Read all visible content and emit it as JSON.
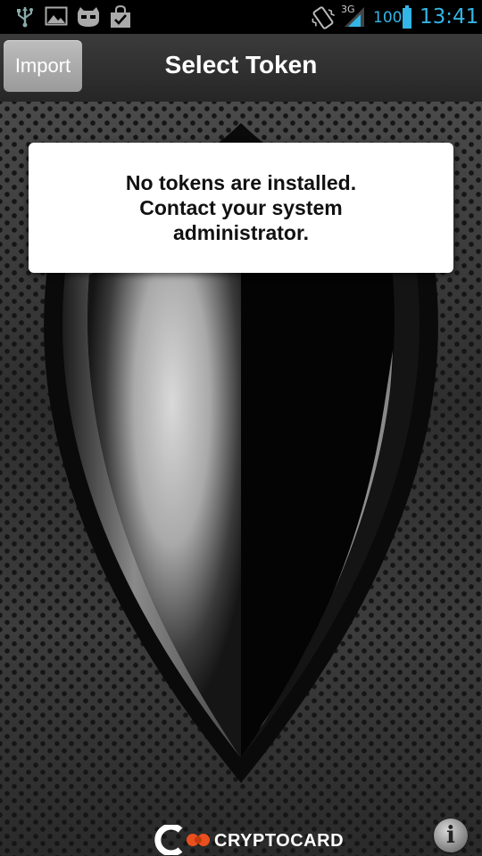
{
  "status_bar": {
    "battery_level": "100",
    "network_type": "3G",
    "time": "13:41",
    "accent_color": "#33b5e5",
    "icons": [
      "usb-icon",
      "image-icon",
      "cyanogen-icon",
      "shopping-bag-check-icon",
      "vibrate-icon",
      "signal-icon",
      "battery-icon"
    ]
  },
  "header": {
    "import_label": "Import",
    "title": "Select Token"
  },
  "dialog": {
    "message": "No tokens are installed.\nContact your system\nadministrator."
  },
  "footer": {
    "brand": "CRYPTOCARD",
    "brand_accent_color": "#e8501f",
    "info_label": "i"
  }
}
